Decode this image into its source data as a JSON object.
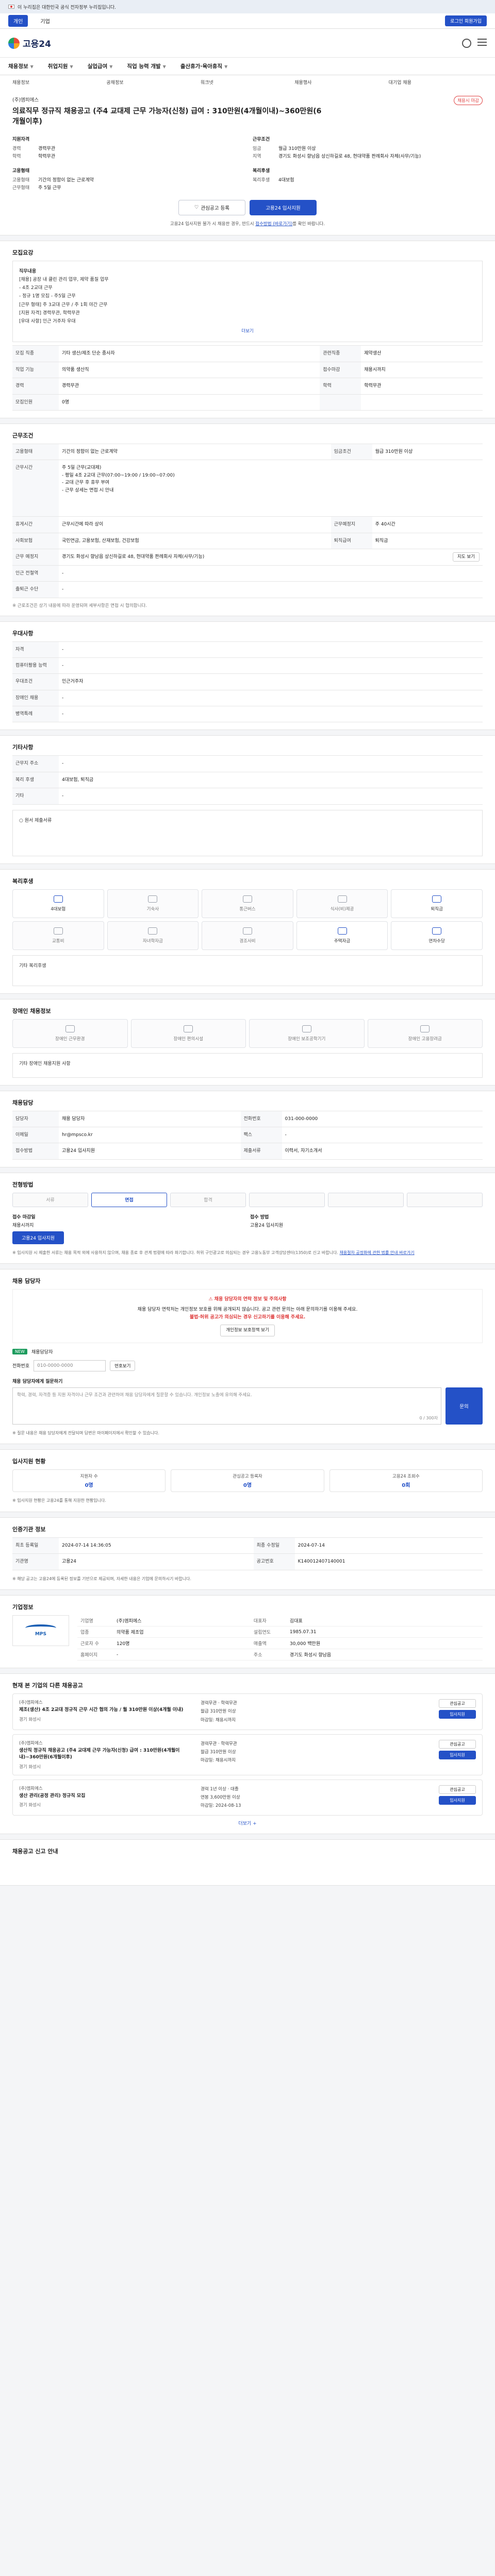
{
  "gov_banner": "이 누리집은 대한민국 공식 전자정부 누리집입니다.",
  "top_tabs": [
    "개인",
    "기업"
  ],
  "top_login": "로그인 회원가입",
  "logo_text": "고용24",
  "gnb": [
    "채용정보",
    "취업지원",
    "실업급여",
    "직업 능력 개발",
    "출산휴가·육아휴직"
  ],
  "subtabs": [
    "채용정보",
    "공채정보",
    "워크넷",
    "채용행사",
    "대기업 채용"
  ],
  "hero": {
    "company": "(주)엠피에스",
    "badge": "채용시 마감",
    "title": "의료직무 정규직 채용공고 (주4 교대제 근무 가능자(신청) 급여 : 310만원(4개월이내)~360만원(6개월이후)",
    "col1_title": "지원자격",
    "col1": [
      [
        "경력",
        "경력무관"
      ],
      [
        "학력",
        "학력무관"
      ],
      [
        "",
        ""
      ]
    ],
    "col2_title": "근무조건",
    "col2": [
      [
        "임금",
        "월급 310만원 이상"
      ],
      [
        "지역",
        "경기도 화성시 향남읍 상신하길로 48, 현대약품 판례회사 자체(사무/기능)"
      ],
      [
        "",
        ""
      ]
    ],
    "col3_title": "고용형태",
    "col3": [
      [
        "고용형태",
        "기간의 정함이 없는 근로계약"
      ],
      [
        "근무형태",
        "주 5일 근무"
      ]
    ],
    "col4_title": "복리후생",
    "col4": [
      [
        "복리후생",
        "4대보험"
      ]
    ],
    "btn_fav": "관심공고 등록",
    "btn_apply": "고용24 입사지원",
    "note_pre": "고용24 입사지원 불가 시 채용한 경우, 반드시",
    "note_link": "접수방법 (바로가기)",
    "note_post": "를 확인 바랍니다."
  },
  "recruit": {
    "title": "모집요강",
    "desc_lines": [
      "직무내용",
      "[채용] 공장 내 클린 관리 업무, 제약 품질 업무",
      " - 4조 2교대 근무",
      " - 정규 1명 모집 - 주5일 근무",
      "[근무 형태] 주 3교대 근무 / 주 1회 야간 근무",
      "[지원 자격] 경력무관, 학력무관",
      "[우대 사항] 인근 거주자 우대"
    ],
    "desc_toggle": "더보기",
    "rows": [
      {
        "k": "모집 직종",
        "v": "기타 생산/제조 단순 종사자",
        "k2": "관련직종",
        "v2": "제약생산"
      },
      {
        "k": "직업 기능",
        "v": "의약품 생산직",
        "k2": "접수마감",
        "v2": "채용시까지"
      },
      {
        "k": "경력",
        "v": "경력무관",
        "k2": "학력",
        "v2": "학력무관"
      },
      {
        "k": "모집인원",
        "v": "0명",
        "k2": "",
        "v2": ""
      }
    ]
  },
  "conditions": {
    "title": "근무조건",
    "rows": [
      {
        "k": "고용형태",
        "v": "기간의 정함이 없는 근로계약",
        "k2": "임금조건",
        "v2": "월급 310만원 이상"
      },
      {
        "k": "근무시간",
        "v": "주 5일 근무(교대제)\n - 평일 4조 2교대 근무(07:00~19:00 / 19:00~07:00)\n - 교대 근무 후 휴무 부여\n - 근무 상세는 면접 시 안내",
        "k2": "",
        "v2": ""
      },
      {
        "k": "휴게시간",
        "v": "근무시간에 따라 상이",
        "k2": "근무예정지",
        "v2": "주 40시간"
      },
      {
        "k": "사회보험",
        "v": "국민연금, 고용보험, 산재보험, 건강보험",
        "k2": "퇴직급여",
        "v2": "퇴직금"
      },
      {
        "k": "근무 예정지",
        "v": "경기도 화성시 향남읍 상신하길로 48, 현대약품 판례회사 자체(사무/기능)",
        "k2": "",
        "v2": ""
      },
      {
        "k": "인근 전철역",
        "v": "-",
        "k2": "",
        "v2": ""
      },
      {
        "k": "출퇴근 수단",
        "v": "-",
        "k2": "",
        "v2": ""
      }
    ],
    "map_btn": "지도 보기",
    "warn": "※ 근로조건은 상기 내용에 따라 운영되며 세부사항은 면접 시 협의합니다."
  },
  "welfare": {
    "title": "우대사항",
    "rows": [
      {
        "k": "자격",
        "v": "-"
      },
      {
        "k": "컴퓨터활용 능력",
        "v": "-"
      },
      {
        "k": "우대조건",
        "v": "인근거주자"
      },
      {
        "k": "장애인 채용",
        "v": "-"
      },
      {
        "k": "병역특례",
        "v": "-"
      }
    ]
  },
  "other": {
    "title": "기타사항",
    "rows": [
      {
        "k": "근무지 주소",
        "v": "-"
      },
      {
        "k": "복리 후생",
        "v": "4대보험, 퇴직금"
      },
      {
        "k": "기타",
        "v": "-"
      }
    ],
    "extra": "○ 원서 제출서류"
  },
  "welfare_icons": {
    "title": "복리후생",
    "items": [
      "4대보험",
      "기숙사",
      "통근버스",
      "식사(비)제공",
      "퇴직금",
      "교통비",
      "자녀학자금",
      "경조사비",
      "주택자금",
      "연차수당"
    ],
    "on": [
      0,
      4,
      8,
      9
    ],
    "footer": "기타 복리후생"
  },
  "disabled": {
    "title": "장애인 채용정보",
    "items": [
      "장애인 근무환경",
      "장애인 편의시설",
      "장애인 보조공학기기",
      "장애인 고용장려금"
    ],
    "note": "기타 장애인 채용지원 사항"
  },
  "manager": {
    "title": "채용담당",
    "rows": [
      {
        "k": "담당자",
        "v": "채용 담당자",
        "k2": "전화번호",
        "v2": "031-000-0000"
      },
      {
        "k": "이메일",
        "v": "hr@mpsco.kr",
        "k2": "팩스",
        "v2": "-"
      },
      {
        "k": "접수방법",
        "v": "고용24 입사지원",
        "k2": "제출서류",
        "v2": "이력서, 자기소개서"
      }
    ]
  },
  "process": {
    "title": "전형방법",
    "steps": [
      "서류",
      "면접",
      "합격",
      "",
      "",
      ""
    ],
    "on": 1,
    "apply_label": "접수 마감일",
    "apply_value": "채용시까지",
    "apply_btn": "고용24 입사지원",
    "method_label": "접수 방법",
    "method_value": "고용24 입사지원",
    "fine": "※ 입사지원 시 제출한 서류는 채용 목적 외에 사용하지 않으며, 채용 종료 후 관계 법령에 따라 파기합니다. 허위 구인광고로 의심되는 경우 고용노동부 고객상담센터(1350)로 신고 바랍니다.",
    "fine_link": "채용절차 공정화에 관한 법률 안내 바로가기"
  },
  "inquiry": {
    "title": "채용 담당자",
    "box_title": "채용 담당자의 연락 정보 및 주의사항",
    "box_text": "채용 담당자 연락처는 개인정보 보호를 위해 공개되지 않습니다. 공고 관련 문의는 아래 문의하기를 이용해 주세요.",
    "box_hl": "불법·허위 공고가 의심되는 경우 신고하기를 이용해 주세요.",
    "chip": "개인정보 보호정책 보기",
    "tag": "NEW",
    "name_label": "채용담당자",
    "phone_label": "전화번호",
    "phone": "010-0000-0000",
    "phone_btn": "번호보기",
    "ta_title": "채용 담당자에게 질문하기",
    "ta_placeholder": "학력, 경력, 자격증 등 지원 자격이나 근무 조건과 관련하여 채용 담당자에게 질문할 수 있습니다. 개인정보 노출에 유의해 주세요.",
    "ta_count": "0 / 300자",
    "ta_btn": "문의",
    "fine": "※ 질문 내용은 채용 담당자에게 전달되며 답변은 마이페이지에서 확인할 수 있습니다."
  },
  "stats": {
    "title": "입사지원 현황",
    "items": [
      {
        "k": "지원자 수",
        "v": "0명"
      },
      {
        "k": "관심공고 등록자",
        "v": "0명"
      },
      {
        "k": "고용24 조회수",
        "v": "0회"
      }
    ],
    "note": "※ 입사지원 현황은 고용24를 통해 지원한 현황입니다."
  },
  "info": {
    "title": "인증기관 정보",
    "rows": [
      {
        "k": "최초 등록일",
        "v": "2024-07-14 14:36:05",
        "k2": "최종 수정일",
        "v2": "2024-07-14"
      },
      {
        "k": "기관명",
        "v": "고용24",
        "k2": "공고번호",
        "v2": "K140012407140001"
      }
    ],
    "fine": "※ 해당 공고는 고용24에 등록된 정보를 기반으로 제공되며, 자세한 내용은 기업에 문의하시기 바랍니다."
  },
  "company": {
    "title": "기업정보",
    "logo": "MPS",
    "rows": [
      [
        "기업명",
        "(주)엠피에스",
        "대표자",
        "김대표"
      ],
      [
        "업종",
        "의약품 제조업",
        "설립연도",
        "1985.07.31"
      ],
      [
        "근로자 수",
        "120명",
        "매출액",
        "30,000 백만원"
      ],
      [
        "홈페이지",
        "-",
        "주소",
        "경기도 화성시 향남읍"
      ]
    ]
  },
  "related": {
    "title": "현재 본 기업의 다른 채용공고",
    "jobs": [
      {
        "co": "(주)엠피에스",
        "title": "제조(생산) 4조 2교대 정규직 근무 시간 협의 가능 / 월 310만원 이상(4개월 이내)",
        "sub": "경기 화성시",
        "m": [
          "경력무관 · 학력무관",
          "월급 310만원 이상",
          "마감일: 채용시까지"
        ],
        "r": [
          "관심공고",
          "입사지원"
        ]
      },
      {
        "co": "(주)엠피에스",
        "title": "생산직 정규직 채용공고 (주4 교대제 근무 가능자(신청) 급여 : 310만원(4개월이내)~360만원(6개월이후)",
        "sub": "경기 화성시",
        "m": [
          "경력무관 · 학력무관",
          "월급 310만원 이상",
          "마감일: 채용시까지"
        ],
        "r": [
          "관심공고",
          "입사지원"
        ]
      },
      {
        "co": "(주)엠피에스",
        "title": "생산 관리(공정 관리) 정규직 모집",
        "sub": "경기 화성시",
        "m": [
          "경력 1년 이상 · 대졸",
          "연봉 3,600만원 이상",
          "마감일: 2024-08-13"
        ],
        "r": [
          "관심공고",
          "입사지원"
        ]
      }
    ],
    "more": "더보기 +"
  },
  "bottom": {
    "title": "채용공고 신고 안내"
  }
}
